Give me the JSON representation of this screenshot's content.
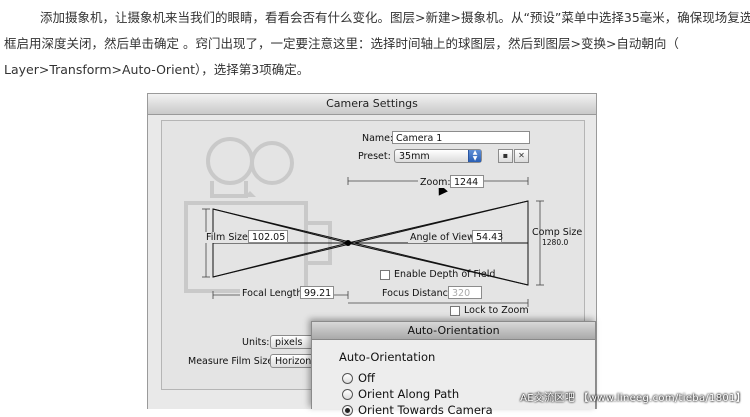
{
  "article": {
    "line1": "添加摄象机，让摄象机来当我们的眼睛，看看会否有什么变化。图层>新建>摄象机。从“预设”菜单中选择35毫米，确保现场复选",
    "line2": "框启用深度关闭，然后单击确定 。窍门出现了，一定要注意这里：选择时间轴上的球图层，然后到图层>变换>自动朝向（",
    "line3": "Layer>Transform>Auto-Orient），选择第3项确定。"
  },
  "camera_settings": {
    "title": "Camera Settings",
    "name_label": "Name:",
    "name_value": "Camera 1",
    "preset_label": "Preset:",
    "preset_value": "35mm",
    "zoom_label": "Zoom:",
    "zoom_value": "1244",
    "film_size_label": "Film Size:",
    "film_size_value": "102.05",
    "angle_label": "Angle of View:",
    "angle_value": "54.43",
    "comp_size_label": "Comp Size",
    "comp_size_value": "1280.0",
    "dof_label": "Enable Depth of Field",
    "focal_label": "Focal Length:",
    "focal_value": "99.21",
    "focus_label": "Focus Distance:",
    "focus_value": "320",
    "lock_label": "Lock to Zoom",
    "units_label": "Units:",
    "units_value": "pixels",
    "measure_label": "Measure Film Size:",
    "measure_value": "Horizonta"
  },
  "auto_orientation": {
    "title": "Auto-Orientation",
    "group_title": "Auto-Orientation",
    "options": [
      "Off",
      "Orient Along Path",
      "Orient Towards Camera"
    ]
  },
  "watermark": "AE交流区吧  【www.lineeg.com/tieba/1801】"
}
